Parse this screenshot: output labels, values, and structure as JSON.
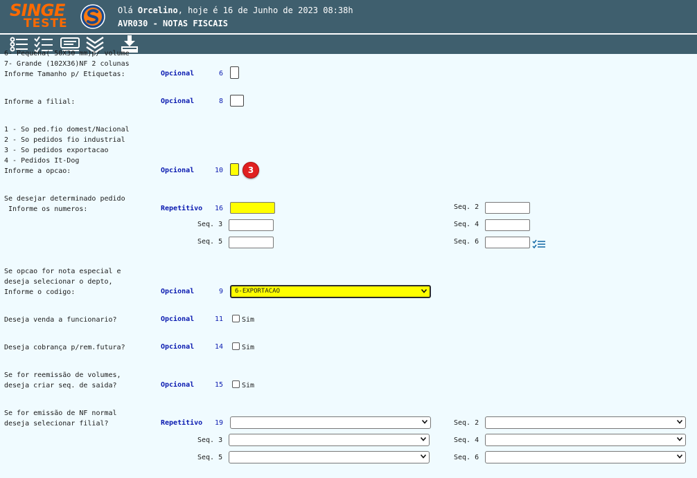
{
  "header": {
    "logo_main": "SINGE",
    "logo_sub": "TESTE",
    "greeting_prefix": "Olá ",
    "user_name": "Orcelino",
    "greeting_suffix": ", hoje é 16 de Junho de 2023 08:38h",
    "screen_title": "AVR030 - NOTAS FISCAIS"
  },
  "toolbar": {
    "icons": [
      "list-icon",
      "checklist-icon",
      "keyboard-icon",
      "double-chevron-down-icon",
      "download-icon"
    ]
  },
  "colors": {
    "header_bg": "#3f5f6e",
    "accent": "#ff6a00",
    "page_bg": "#f0fbff",
    "label_blue": "#0a1ab0",
    "highlight": "#ffff00",
    "badge": "#e02020"
  },
  "form": {
    "tamanho": {
      "lines": [
        "6- Pequena( 50X30 mm)p/ volume",
        "7- Grande (102X36)NF 2 colunas",
        "Informe Tamanho p/ Etiquetas:"
      ],
      "mode": "Opcional",
      "num": "6"
    },
    "filial": {
      "label": "Informe a filial:",
      "mode": "Opcional",
      "num": "8"
    },
    "opcao": {
      "lines": [
        "1 - So ped.fio domest/Nacional",
        "2 - So pedidos fio industrial",
        "3 - So pedidos exportacao",
        "4 - Pedidos It-Dog",
        "Informe a opcao:"
      ],
      "mode": "Opcional",
      "num": "10",
      "badge": "3"
    },
    "pedidos": {
      "lines": [
        "Se desejar determinado pedido",
        " Informe os numeros:"
      ],
      "mode": "Repetitivo",
      "num": "16",
      "seq_labels": [
        "Seq. 2",
        "Seq. 3",
        "Seq. 4",
        "Seq. 5",
        "Seq. 6"
      ]
    },
    "depto": {
      "lines": [
        "Se opcao for nota especial e",
        "deseja selecionar o depto,",
        "Informe o codigo:"
      ],
      "mode": "Opcional",
      "num": "9",
      "selected": "6-EXPORTACAO"
    },
    "venda": {
      "label": "Deseja venda a funcionario?",
      "mode": "Opcional",
      "num": "11",
      "check": "Sim"
    },
    "cobranca": {
      "label": "Deseja cobrança p/rem.futura?",
      "mode": "Opcional",
      "num": "14",
      "check": "Sim"
    },
    "reemissao": {
      "lines": [
        "Se for reemissão de volumes,",
        "deseja criar seq. de saida?"
      ],
      "mode": "Opcional",
      "num": "15",
      "check": "Sim"
    },
    "filial_nf": {
      "lines": [
        "Se for emissão de NF normal",
        "deseja selecionar filial?"
      ],
      "mode": "Repetitivo",
      "num": "19",
      "seq_labels": [
        "Seq. 2",
        "Seq. 3",
        "Seq. 4",
        "Seq. 5",
        "Seq. 6"
      ]
    }
  }
}
